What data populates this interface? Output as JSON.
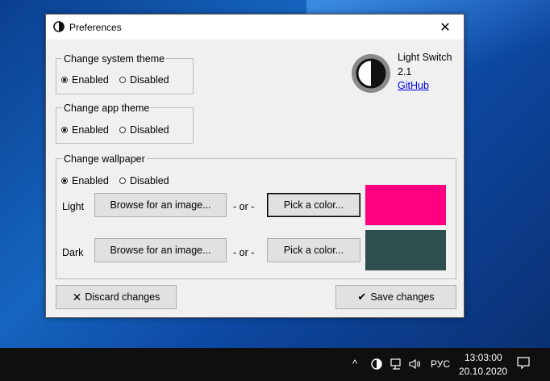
{
  "window": {
    "title": "Preferences",
    "close_glyph": "✕"
  },
  "system_theme": {
    "legend": "Change system theme",
    "enabled_label": "Enabled",
    "disabled_label": "Disabled",
    "selected": "Enabled"
  },
  "app_theme": {
    "legend": "Change app theme",
    "enabled_label": "Enabled",
    "disabled_label": "Disabled",
    "selected": "Enabled"
  },
  "about": {
    "app_name": "Light Switch",
    "version": "2.1",
    "link_text": "GitHub",
    "logo_icon": "half-moon-icon"
  },
  "wallpaper": {
    "legend": "Change wallpaper",
    "enabled_label": "Enabled",
    "disabled_label": "Disabled",
    "selected": "Enabled",
    "rows": [
      {
        "label": "Light",
        "browse_label": "Browse for an image...",
        "or_text": "- or -",
        "pick_label": "Pick a color...",
        "color": "#ff0080"
      },
      {
        "label": "Dark",
        "browse_label": "Browse for an image...",
        "or_text": "- or -",
        "pick_label": "Pick a color...",
        "color": "#2f4f4f"
      }
    ]
  },
  "footer": {
    "discard_glyph": "✕",
    "discard_label": "Discard changes",
    "save_glyph": "✔",
    "save_label": "Save changes"
  },
  "taskbar": {
    "chevron": "^",
    "language": "РУС",
    "time": "13:03:00",
    "date": "20.10.2020"
  }
}
